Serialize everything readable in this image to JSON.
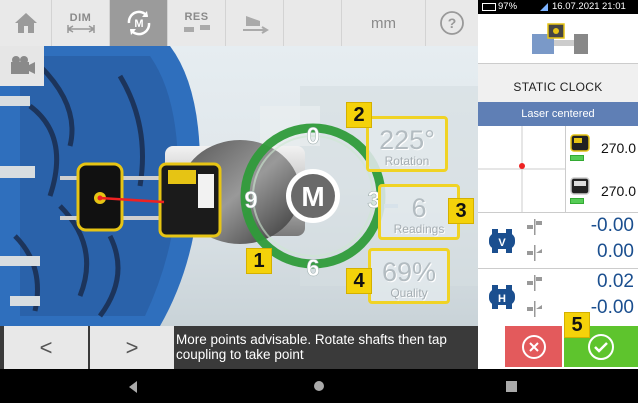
{
  "toolbar": {
    "dim_label": "DIM",
    "res_label": "RES",
    "units_label": "mm",
    "help_label": "?"
  },
  "scene": {
    "clock_labels": {
      "top": "0",
      "left": "9",
      "right": "3",
      "bottom": "6"
    },
    "center_logo": "M",
    "rotation_value": "225°",
    "rotation_label": "Rotation",
    "readings_value": "6",
    "readings_label": "Readings",
    "quality_value": "69%",
    "quality_label": "Quality",
    "badges": [
      "1",
      "2",
      "3",
      "4",
      "5"
    ]
  },
  "bottom": {
    "message": "More points advisable. Rotate shafts then tap coupling to take point",
    "prev_label": "<",
    "next_label": ">"
  },
  "status_bar": {
    "battery": "97%",
    "date": "16.07.2021",
    "time": "21:01"
  },
  "panel": {
    "mode": "STATIC CLOCK",
    "laser_status": "Laser centered",
    "angle_top": "270.0",
    "angle_bottom": "270.0",
    "vertical": {
      "label": "V",
      "offset": "-0.00",
      "angularity": "0.00"
    },
    "horizontal": {
      "label": "H",
      "offset": "0.02",
      "angularity": "-0.00"
    }
  },
  "colors": {
    "accent_yellow": "#f4d20a",
    "laser_blue": "#5f7fb5",
    "result_blue": "#1b4f8f",
    "cancel_red": "#e35a5c",
    "ok_green": "#5ec42d",
    "clock_green": "#2f9b3a"
  }
}
